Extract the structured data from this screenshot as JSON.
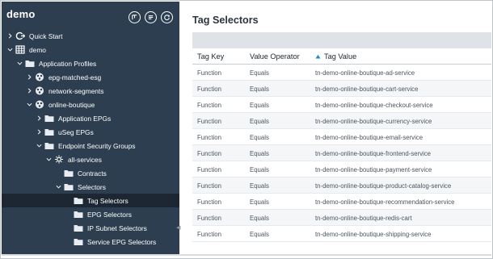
{
  "sidebar": {
    "title": "demo",
    "header_icons": [
      "filter-icon",
      "list-icon",
      "refresh-icon"
    ],
    "items": [
      {
        "label": "Quick Start",
        "level": 0,
        "expanded": false,
        "icon": "quickstart-icon"
      },
      {
        "label": "demo",
        "level": 0,
        "expanded": true,
        "icon": "grid-icon"
      },
      {
        "label": "Application Profiles",
        "level": 1,
        "expanded": true,
        "icon": "folder-icon"
      },
      {
        "label": "epg-matched-esg",
        "level": 2,
        "expanded": false,
        "icon": "app-profile-icon"
      },
      {
        "label": "network-segments",
        "level": 2,
        "expanded": false,
        "icon": "app-profile-icon"
      },
      {
        "label": "online-boutique",
        "level": 2,
        "expanded": true,
        "icon": "app-profile-icon"
      },
      {
        "label": "Application EPGs",
        "level": 3,
        "expanded": false,
        "icon": "folder-icon"
      },
      {
        "label": "uSeg EPGs",
        "level": 3,
        "expanded": false,
        "icon": "folder-icon"
      },
      {
        "label": "Endpoint Security Groups",
        "level": 3,
        "expanded": true,
        "icon": "folder-icon"
      },
      {
        "label": "all-services",
        "level": 4,
        "expanded": true,
        "icon": "esg-icon"
      },
      {
        "label": "Contracts",
        "level": 5,
        "expanded": null,
        "icon": "folder-icon"
      },
      {
        "label": "Selectors",
        "level": 5,
        "expanded": true,
        "icon": "folder-icon"
      },
      {
        "label": "Tag Selectors",
        "level": 6,
        "expanded": null,
        "icon": "folder-icon",
        "selected": true
      },
      {
        "label": "EPG Selectors",
        "level": 6,
        "expanded": null,
        "icon": "folder-icon"
      },
      {
        "label": "IP Subnet Selectors",
        "level": 6,
        "expanded": null,
        "icon": "folder-icon"
      },
      {
        "label": "Service EPG Selectors",
        "level": 6,
        "expanded": null,
        "icon": "folder-icon"
      }
    ]
  },
  "main": {
    "title": "Tag Selectors",
    "columns": [
      "Tag Key",
      "Value Operator",
      "Tag Value"
    ],
    "sorted_column": "Tag Value",
    "sort_direction": "ascending",
    "rows": [
      [
        "Function",
        "Equals",
        "tn-demo-online-boutique-ad-service"
      ],
      [
        "Function",
        "Equals",
        "tn-demo-online-boutique-cart-service"
      ],
      [
        "Function",
        "Equals",
        "tn-demo-online-boutique-checkout-service"
      ],
      [
        "Function",
        "Equals",
        "tn-demo-online-boutique-currency-service"
      ],
      [
        "Function",
        "Equals",
        "tn-demo-online-boutique-email-service"
      ],
      [
        "Function",
        "Equals",
        "tn-demo-online-boutique-frontend-service"
      ],
      [
        "Function",
        "Equals",
        "tn-demo-online-boutique-payment-service"
      ],
      [
        "Function",
        "Equals",
        "tn-demo-online-boutique-product-catalog-service"
      ],
      [
        "Function",
        "Equals",
        "tn-demo-online-boutique-recommendation-service"
      ],
      [
        "Function",
        "Equals",
        "tn-demo-online-boutique-redis-cart"
      ],
      [
        "Function",
        "Equals",
        "tn-demo-online-boutique-shipping-service"
      ]
    ]
  },
  "colors": {
    "sidebar_bg": "#2d3e50",
    "sidebar_selected": "#1c2733",
    "toolbar_band": "#dfe3e7",
    "sort_arrow": "#1f8ad1"
  }
}
